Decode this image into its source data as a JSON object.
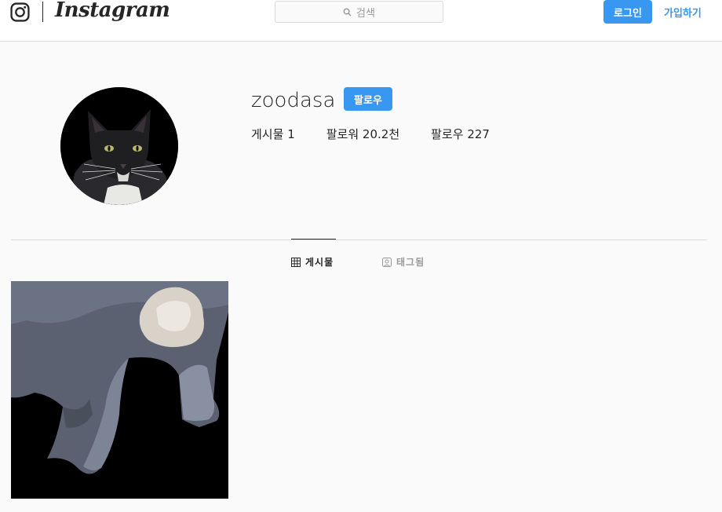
{
  "header": {
    "wordmark": "Instagram",
    "search_placeholder": "검색",
    "login_label": "로그인",
    "signup_label": "가입하기"
  },
  "profile": {
    "username": "zoodasa",
    "follow_label": "팔로우",
    "posts_label": "게시물",
    "posts_count": "1",
    "followers_label": "팔로워",
    "followers_count": "20.2천",
    "following_label": "팔로우",
    "following_count": "227"
  },
  "tabs": [
    {
      "label": "게시물",
      "icon": "grid-icon",
      "active": true
    },
    {
      "label": "태그됨",
      "icon": "tagged-icon",
      "active": false
    }
  ],
  "colors": {
    "accent": "#3897f0",
    "text": "#262626",
    "muted": "#999999",
    "border": "#dbdbdb",
    "background": "#fafafa"
  }
}
